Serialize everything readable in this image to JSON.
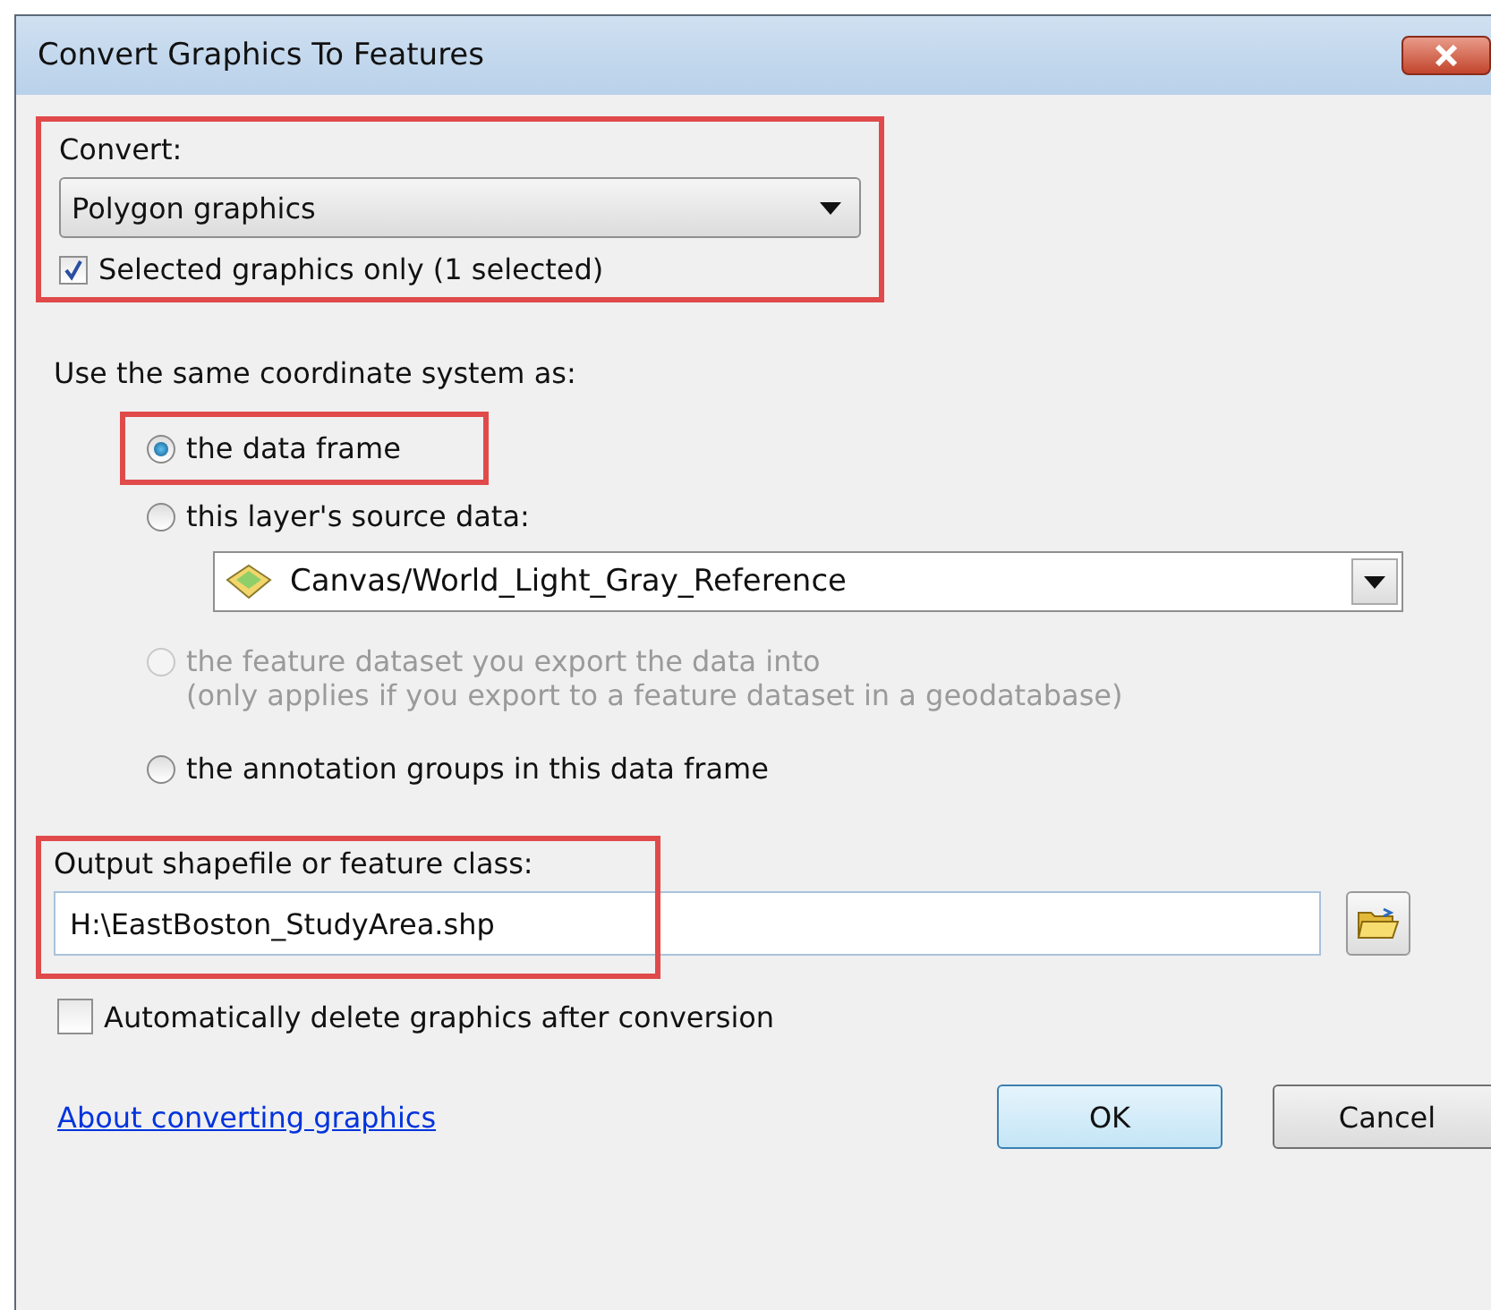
{
  "window": {
    "title": "Convert Graphics To Features"
  },
  "convert": {
    "label": "Convert:",
    "highlighted": true,
    "dropdown": {
      "value": "Polygon graphics"
    },
    "selected_only": {
      "label": "Selected graphics only  (1 selected)",
      "checked": true
    }
  },
  "coordinate_system": {
    "label": "Use the same coordinate system as:",
    "options": [
      {
        "label": "the data frame",
        "selected": true,
        "disabled": false,
        "highlighted": true
      },
      {
        "label": "this layer's source data:",
        "selected": false,
        "disabled": false,
        "highlighted": false,
        "layer_dropdown": {
          "value": "Canvas/World_Light_Gray_Reference"
        }
      },
      {
        "label": "the feature dataset you export the data into",
        "note": "(only applies if you export to a feature dataset in a geodatabase)",
        "selected": false,
        "disabled": true,
        "highlighted": false
      },
      {
        "label": "the annotation groups in this data frame",
        "selected": false,
        "disabled": false,
        "highlighted": false
      }
    ]
  },
  "output": {
    "label": "Output shapefile or feature class:",
    "highlighted": true,
    "value": "H:\\EastBoston_StudyArea.shp"
  },
  "auto_delete": {
    "label": "Automatically delete graphics after conversion",
    "checked": false
  },
  "help_link": "About converting graphics",
  "buttons": [
    "OK",
    "Cancel"
  ]
}
